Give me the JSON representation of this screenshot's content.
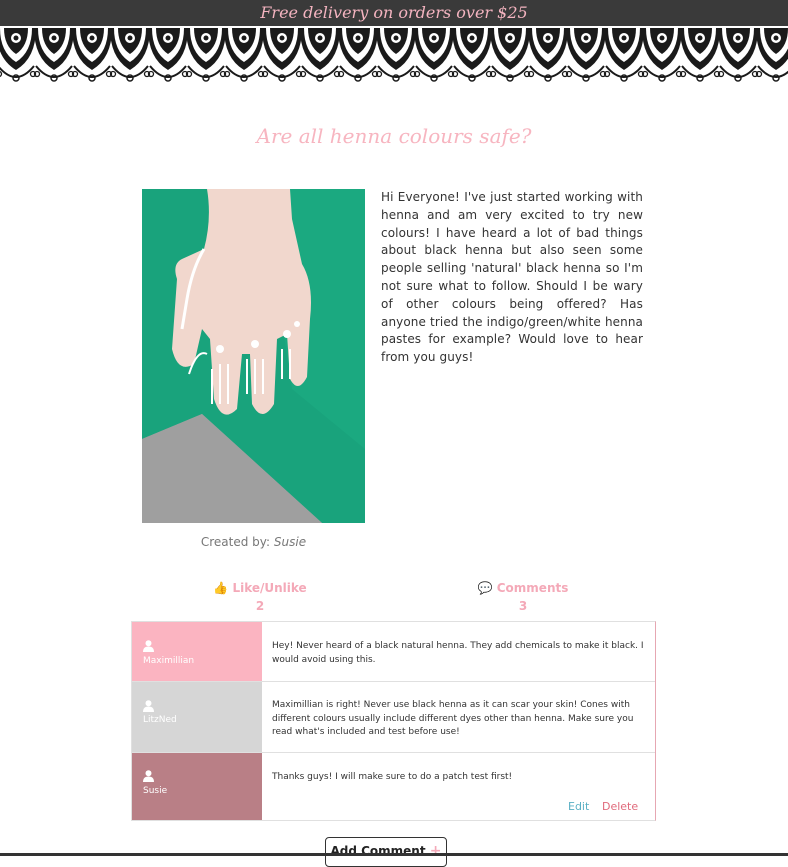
{
  "promo": {
    "text": "Free delivery on orders over $25"
  },
  "post": {
    "title": "Are all henna colours safe?",
    "body": "Hi Everyone! I've just started working with henna and am very excited to try new colours! I have heard a lot of bad things about black henna but also seen some people selling 'natural' black henna so I'm not sure what to follow. Should I be wary of other colours being offered? Has anyone tried the indigo/green/white henna pastes for example? Would love to hear from you guys!",
    "created_label": "Created by:",
    "author": "Susie"
  },
  "stats": {
    "like_label": "Like/Unlike",
    "like_count": "2",
    "comments_label": "Comments",
    "comments_count": "3"
  },
  "comments": [
    {
      "user": "Maximillian",
      "text": "Hey! Never heard of a black natural henna. They add chemicals to make it black. I would avoid using this.",
      "color": "#fbb4c1"
    },
    {
      "user": "LitzNed",
      "text": "Maximillian is right! Never use black henna as it can scar your skin! Cones with different colours usually include different dyes other than henna. Make sure you read what's included and test before use!",
      "color": "#d6d6d6"
    },
    {
      "user": "Susie",
      "text": "Thanks guys! I will make sure to do a patch test first!",
      "color": "#b97f86",
      "edit_label": "Edit",
      "delete_label": "Delete"
    }
  ],
  "actions": {
    "add_comment_label": "Add Comment",
    "add_comment_icon": "plus-icon"
  },
  "colors": {
    "accent_pink": "#f4a9b8",
    "promo_bg": "#3a3a3a",
    "edit": "#5ab0c4",
    "delete": "#e06a7b"
  }
}
